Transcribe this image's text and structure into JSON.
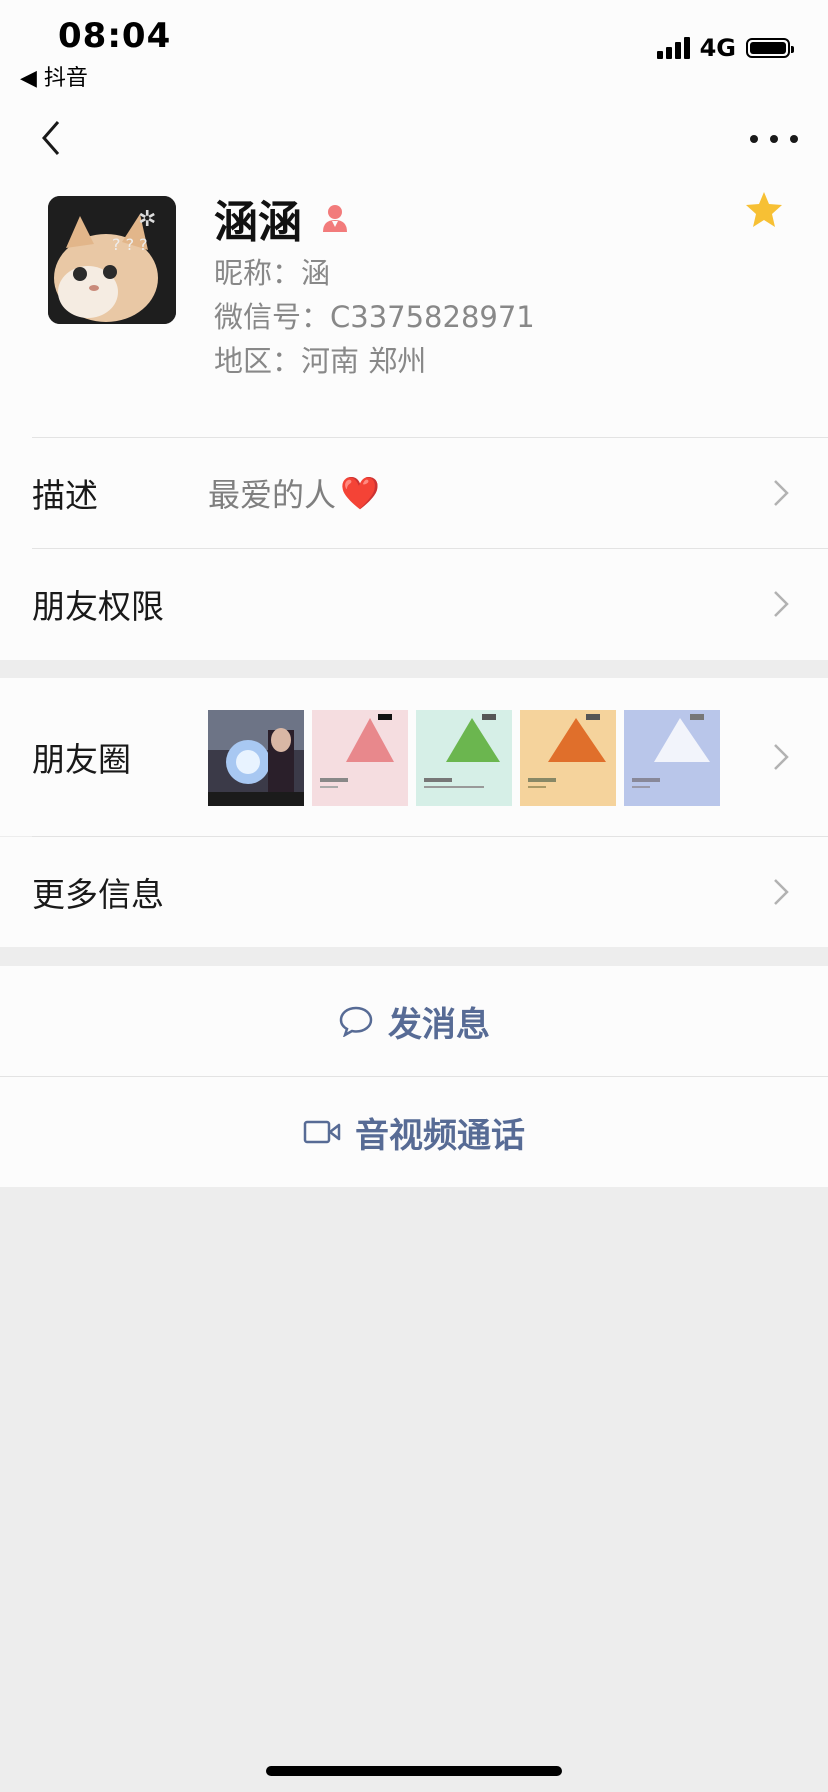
{
  "status_bar": {
    "time": "08:04",
    "back_app": "◀ 抖音",
    "network": "4G"
  },
  "nav": {
    "back_icon": "chevron-left-icon",
    "more_icon": "more-dots-icon"
  },
  "profile": {
    "name": "涵涵",
    "gender_icon": "female-icon",
    "star_icon": "star-icon",
    "nickname": "昵称：涵",
    "wechat_id": "微信号：C3375828971",
    "region": "地区：河南 郑州",
    "colors": {
      "gender": "#f27b7b",
      "star": "#f7c034"
    }
  },
  "rows": {
    "description": {
      "label": "描述",
      "value": "最爱的人",
      "emoji": "❤️"
    },
    "permissions": {
      "label": "朋友权限"
    },
    "moments": {
      "label": "朋友圈"
    },
    "more_info": {
      "label": "更多信息"
    }
  },
  "actions": {
    "message": {
      "label": "发消息",
      "icon": "chat-bubble-icon"
    },
    "call": {
      "label": "音视频通话",
      "icon": "video-camera-icon"
    }
  },
  "colors": {
    "link": "#576b95",
    "background": "#ededed"
  }
}
